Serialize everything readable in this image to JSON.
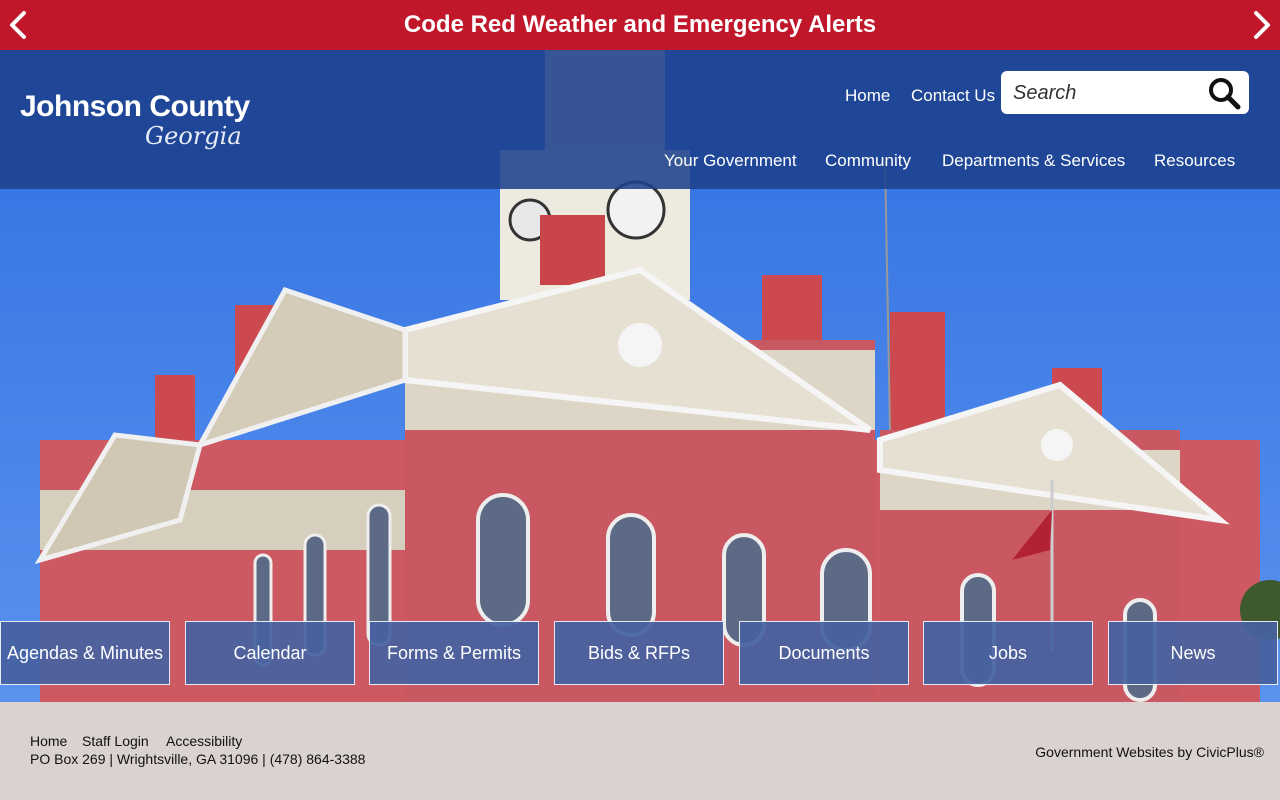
{
  "alert": {
    "text": "Code Red Weather and Emergency Alerts",
    "prev_icon": "chevron-left-icon",
    "next_icon": "chevron-right-icon"
  },
  "logo": {
    "title": "Johnson County",
    "subtitle": "Georgia"
  },
  "utility_nav": [
    {
      "label": "Home"
    },
    {
      "label": "Contact Us"
    }
  ],
  "search": {
    "placeholder": "Search",
    "icon": "search-icon"
  },
  "main_nav": [
    {
      "label": "Your Government"
    },
    {
      "label": "Community"
    },
    {
      "label": "Departments & Services"
    },
    {
      "label": "Resources"
    }
  ],
  "quick_links": [
    {
      "label": "Agendas & Minutes"
    },
    {
      "label": "Calendar"
    },
    {
      "label": "Forms & Permits"
    },
    {
      "label": "Bids & RFPs"
    },
    {
      "label": "Documents"
    },
    {
      "label": "Jobs"
    },
    {
      "label": "News"
    }
  ],
  "footer": {
    "links": [
      {
        "label": "Home"
      },
      {
        "label": "Staff Login"
      },
      {
        "label": "Accessibility"
      }
    ],
    "address": "PO Box 269 | Wrightsville, GA 31096 | (478) 864-3388",
    "credit": "Government Websites by CivicPlus®"
  },
  "colors": {
    "alert_bg": "#c0172a",
    "header_bg": "#1e418c",
    "quick_link_bg": "#4662a0",
    "footer_bg": "#d9d2cf"
  }
}
